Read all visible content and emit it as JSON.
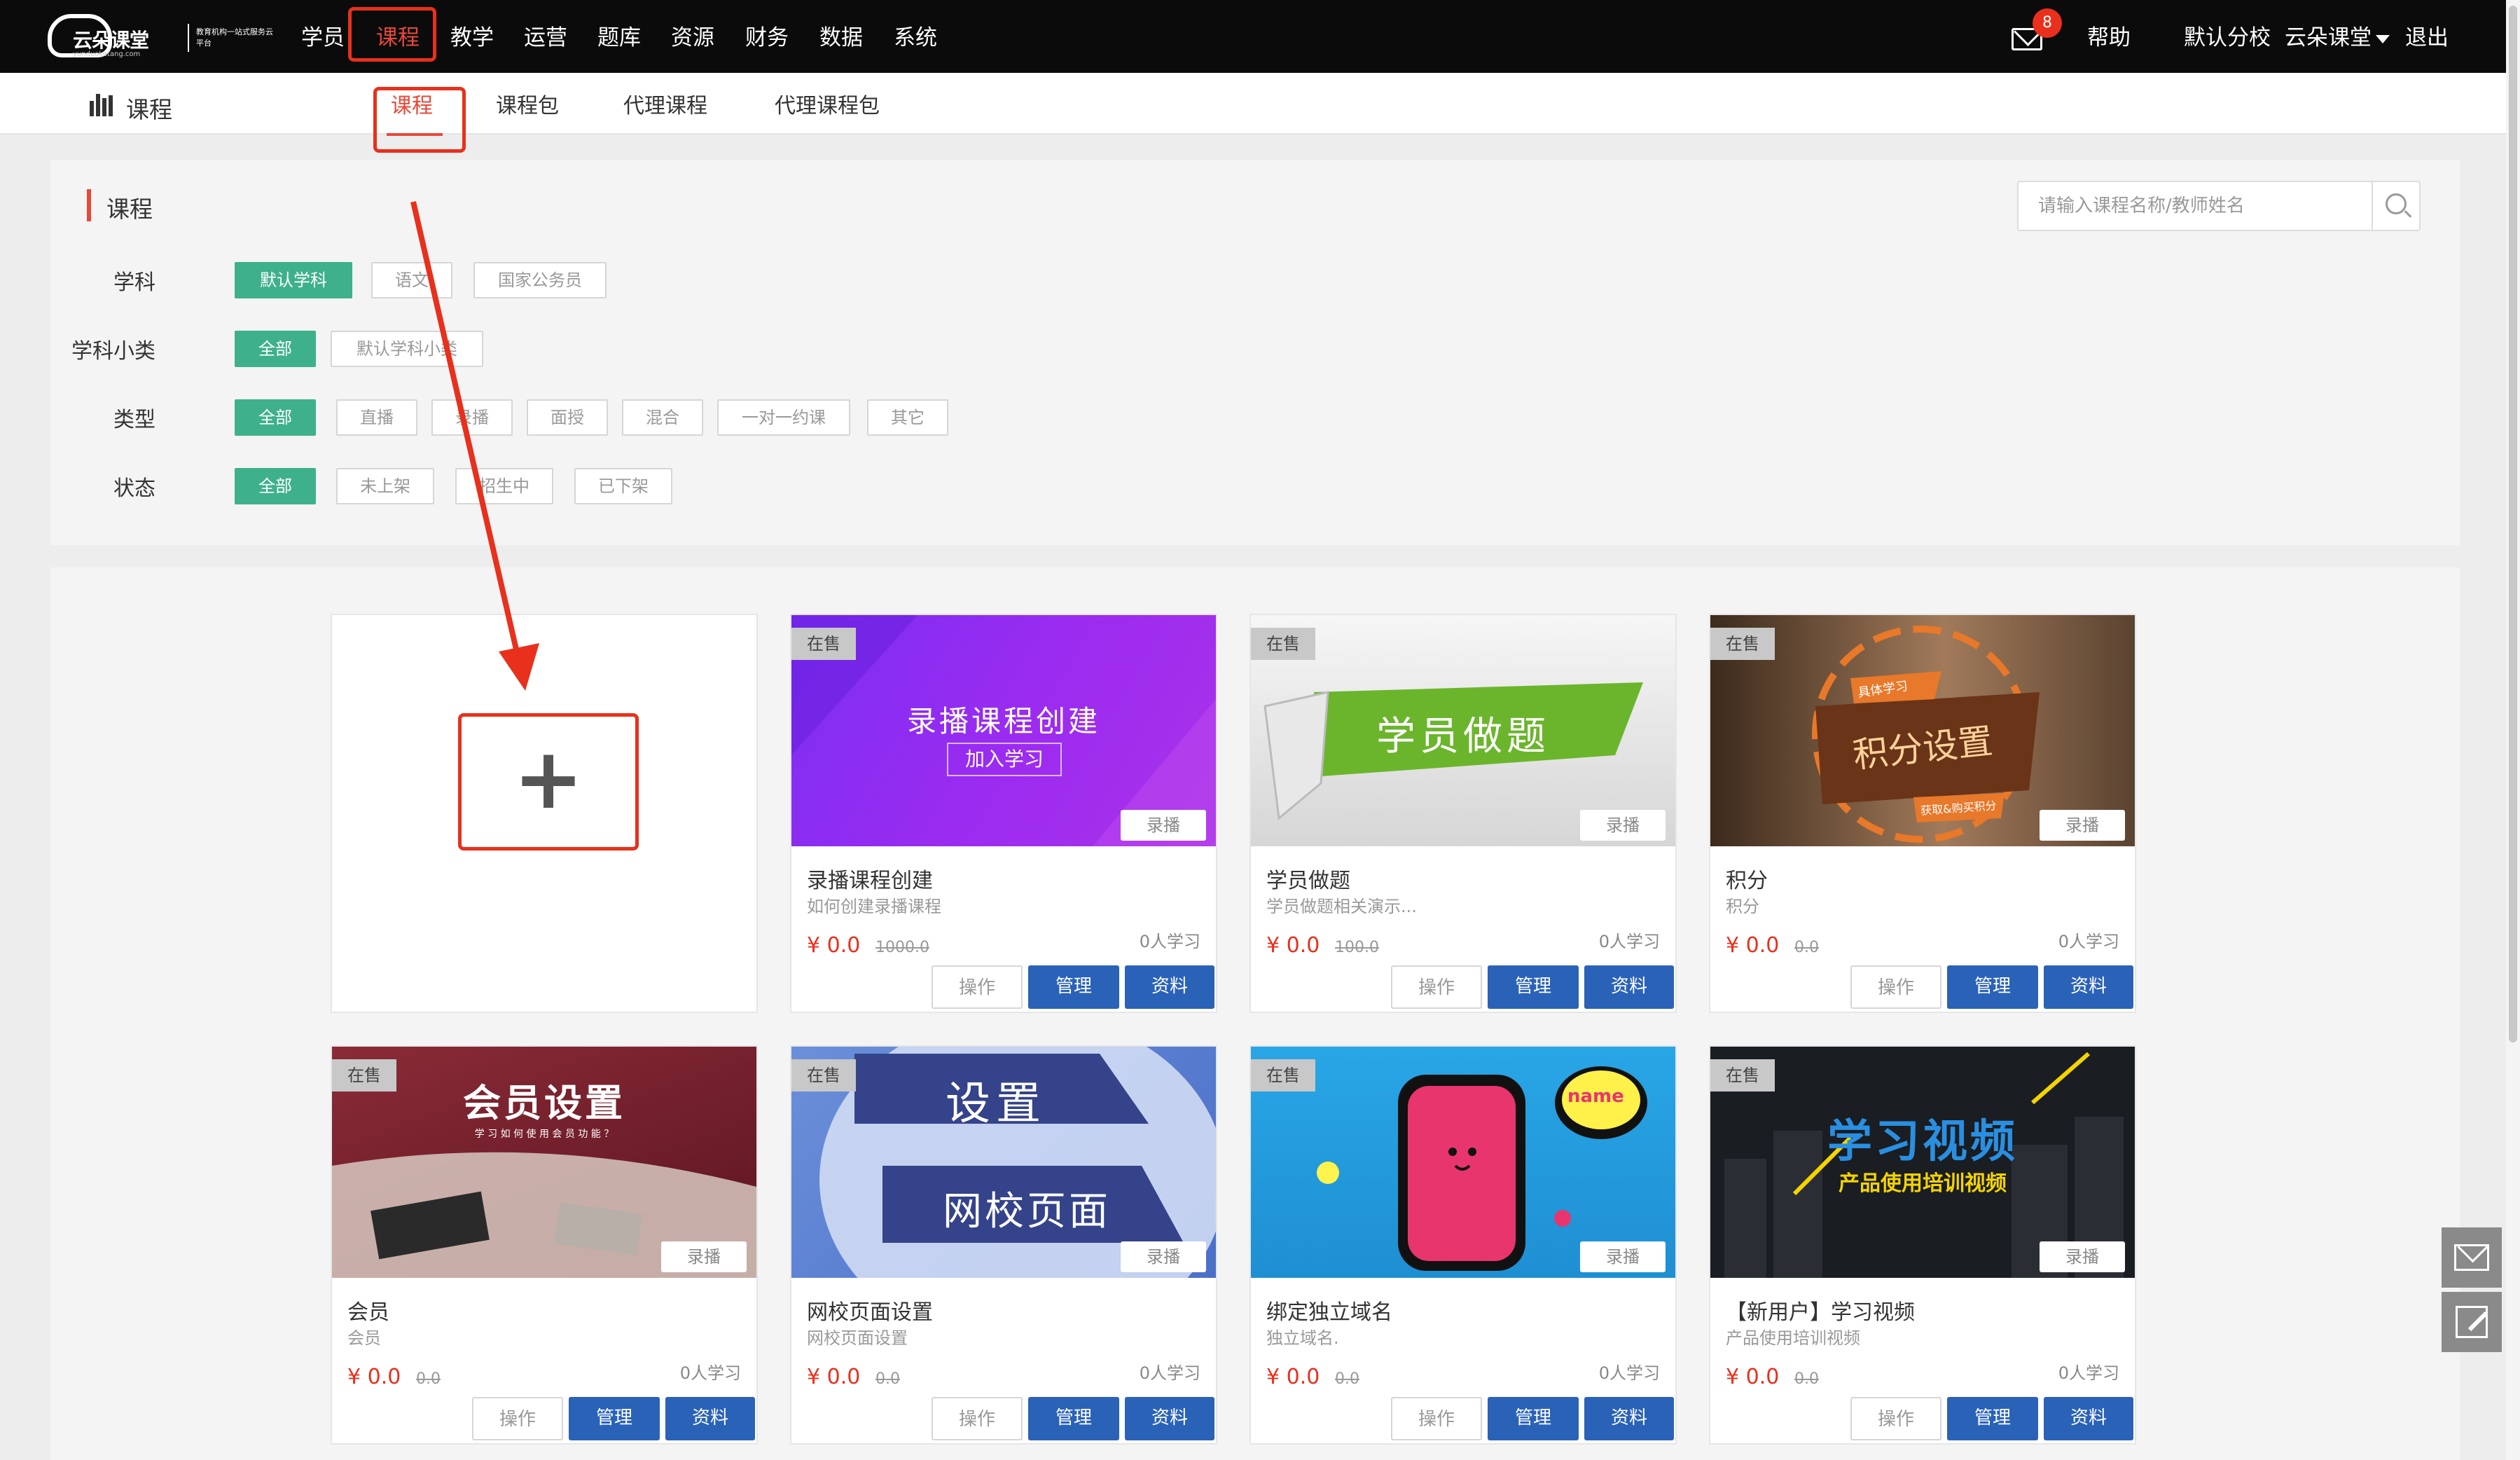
{
  "topnav": {
    "logo_name": "云朵课堂",
    "logo_url": "yunduoketang.com",
    "logo_slogan": "教育机构一站式服务云平台",
    "items": [
      "学员",
      "课程",
      "教学",
      "运营",
      "题库",
      "资源",
      "财务",
      "数据",
      "系统"
    ],
    "active_index": 1,
    "mail_badge": "8",
    "help": "帮助",
    "school": "默认分校",
    "user": "云朵课堂",
    "logout": "退出"
  },
  "subnav": {
    "title": "课程",
    "tabs": [
      "课程",
      "课程包",
      "代理课程",
      "代理课程包"
    ],
    "active_index": 0
  },
  "filters": {
    "panel_title": "课程",
    "search_placeholder": "请输入课程名称/教师姓名",
    "groups": [
      {
        "label": "学科",
        "options": [
          "默认学科",
          "语文",
          "国家公务员"
        ],
        "selected": 0
      },
      {
        "label": "学科小类",
        "options": [
          "全部",
          "默认学科小类"
        ],
        "selected": 0
      },
      {
        "label": "类型",
        "options": [
          "全部",
          "直播",
          "录播",
          "面授",
          "混合",
          "一对一约课",
          "其它"
        ],
        "selected": 0
      },
      {
        "label": "状态",
        "options": [
          "全部",
          "未上架",
          "招生中",
          "已下架"
        ],
        "selected": 0
      }
    ]
  },
  "add_card": {
    "symbol": "+"
  },
  "cards": [
    {
      "status": "在售",
      "type": "录播",
      "thumb_line1": "录播课程创建",
      "thumb_line2": "加入学习",
      "title": "录播课程创建",
      "desc": "如何创建录播课程",
      "price": "¥ 0.0",
      "old_price": "1000.0",
      "learners": "0人学习"
    },
    {
      "status": "在售",
      "type": "录播",
      "thumb_line1": "学员做题",
      "thumb_line2": "",
      "title": "学员做题",
      "desc": "学员做题相关演示...",
      "price": "¥ 0.0",
      "old_price": "100.0",
      "learners": "0人学习"
    },
    {
      "status": "在售",
      "type": "录播",
      "thumb_line1": "积分设置",
      "thumb_line2": "具体学习",
      "thumb_line3": "获取&购买积分",
      "title": "积分",
      "desc": "积分",
      "price": "¥ 0.0",
      "old_price": "0.0",
      "learners": "0人学习"
    },
    {
      "status": "在售",
      "type": "录播",
      "thumb_line1": "会员设置",
      "thumb_line2": "学 习 如 何 使 用 会 员 功 能 ？",
      "title": "会员",
      "desc": "会员",
      "price": "¥ 0.0",
      "old_price": "0.0",
      "learners": "0人学习"
    },
    {
      "status": "在售",
      "type": "录播",
      "thumb_line1": "设置",
      "thumb_line2": "网校页面",
      "title": "网校页面设置",
      "desc": "网校页面设置",
      "price": "¥ 0.0",
      "old_price": "0.0",
      "learners": "0人学习"
    },
    {
      "status": "在售",
      "type": "录播",
      "thumb_line1": "name",
      "thumb_line2": "",
      "title": "绑定独立域名",
      "desc": "独立域名.",
      "price": "¥ 0.0",
      "old_price": "0.0",
      "learners": "0人学习"
    },
    {
      "status": "在售",
      "type": "录播",
      "thumb_line1": "学习视频",
      "thumb_line2": "产品使用培训视频",
      "title": "【新用户】学习视频",
      "desc": "产品使用培训视频",
      "price": "¥ 0.0",
      "old_price": "0.0",
      "learners": "0人学习"
    }
  ],
  "buttons": {
    "operate": "操作",
    "manage": "管理",
    "resource": "资料"
  },
  "colors": {
    "accent_red": "#e8301c",
    "chip_green": "#3eb08c",
    "button_blue": "#2a62b8"
  }
}
